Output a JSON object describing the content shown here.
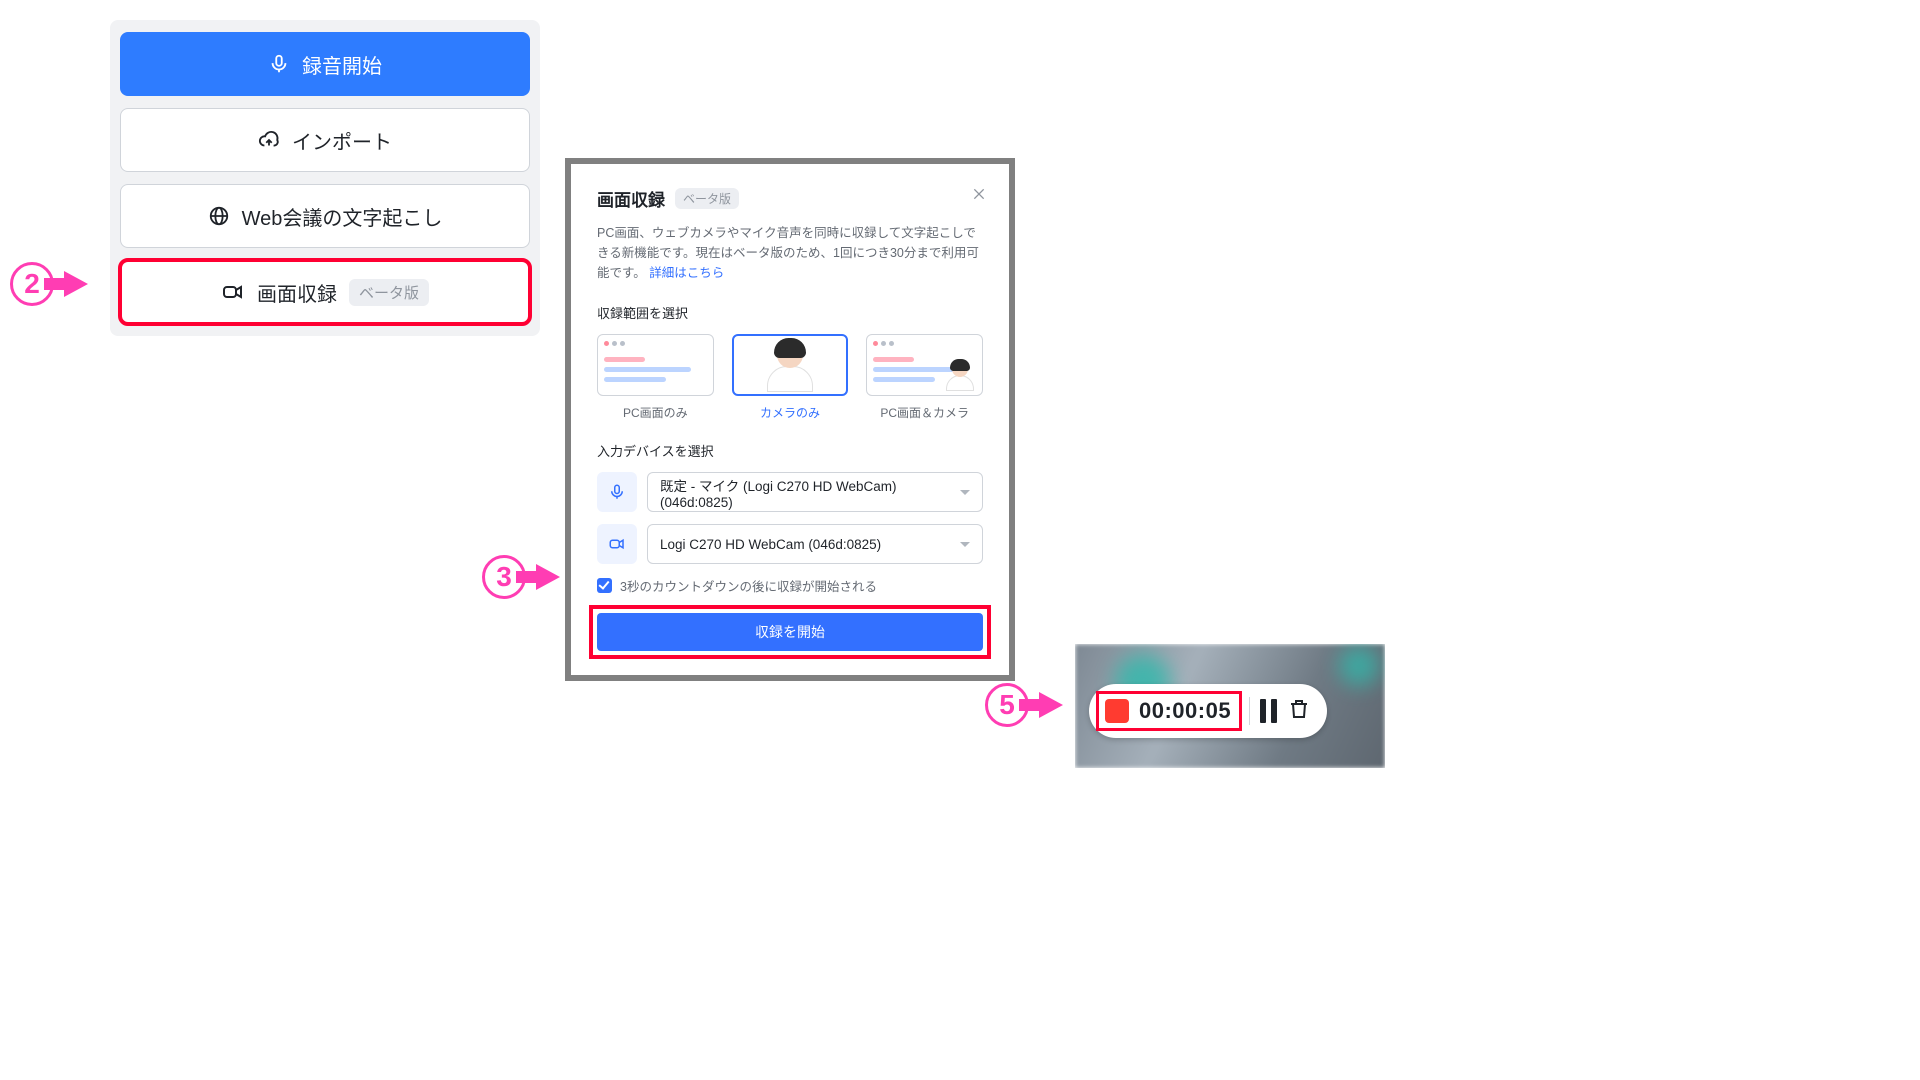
{
  "menu": {
    "record_label": "録音開始",
    "import_label": "インポート",
    "web_meeting_label": "Web会議の文字起こし",
    "screen_record_label": "画面収録",
    "beta_badge": "ベータ版"
  },
  "steps": {
    "s2": "2",
    "s3": "3",
    "s5": "5"
  },
  "modal": {
    "title": "画面収録",
    "beta_badge": "ベータ版",
    "desc1": "PC画面、ウェブカメラやマイク音声を同時に収録して文字起こしできる新機能です。現在はベータ版のため、1回につき30分まで利用可能です。",
    "link": "詳細はこちら",
    "scope_label": "収録範囲を選択",
    "scopes": {
      "pc_only": "PC画面のみ",
      "camera_only": "カメラのみ",
      "pc_and_camera": "PC画面＆カメラ"
    },
    "device_label": "入力デバイスを選択",
    "mic_value": "既定 - マイク (Logi C270 HD WebCam) (046d:0825)",
    "cam_value": "Logi C270 HD WebCam (046d:0825)",
    "countdown_label": "3秒のカウントダウンの後に収録が開始される",
    "start_label": "収録を開始"
  },
  "recorder": {
    "elapsed": "00:00:05"
  }
}
